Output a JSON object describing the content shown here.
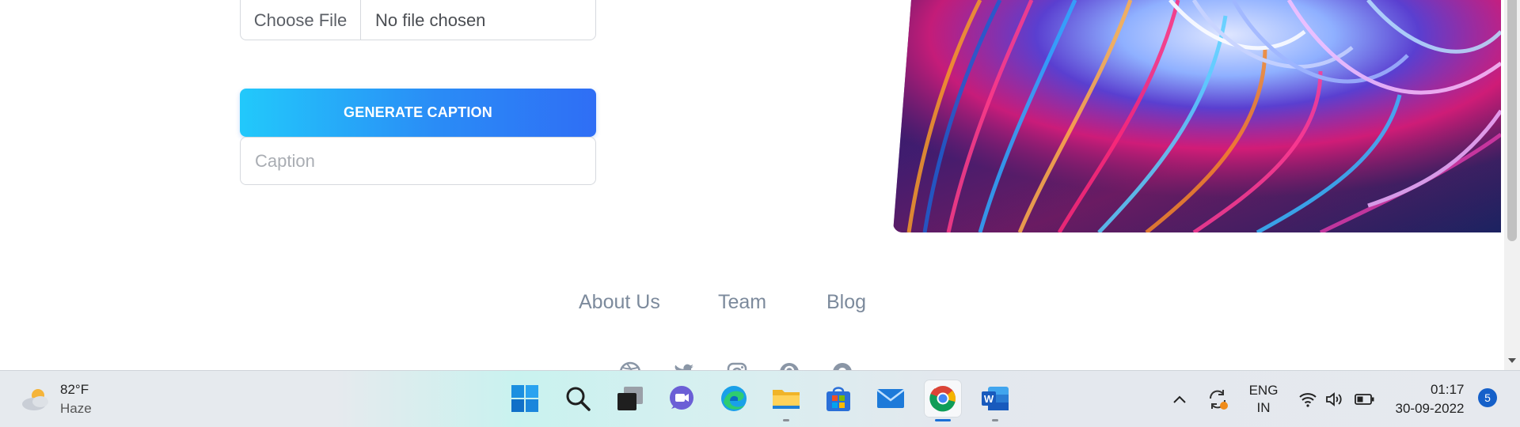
{
  "form": {
    "file_button_label": "Choose File",
    "file_status": "No file chosen",
    "generate_button_label": "GENERATE CAPTION",
    "caption_placeholder": "Caption",
    "caption_value": ""
  },
  "footer": {
    "links": [
      {
        "label": "About Us"
      },
      {
        "label": "Team"
      },
      {
        "label": "Blog"
      }
    ],
    "social_icons": [
      "dribbble-icon",
      "twitter-icon",
      "instagram-icon",
      "pinterest-icon",
      "github-icon"
    ]
  },
  "taskbar": {
    "weather": {
      "temperature": "82°F",
      "condition": "Haze"
    },
    "apps": [
      "start-icon",
      "search-icon",
      "task-view-icon",
      "teams-chat-icon",
      "edge-icon",
      "file-explorer-icon",
      "microsoft-store-icon",
      "mail-icon",
      "chrome-icon",
      "word-icon"
    ],
    "language": {
      "line1": "ENG",
      "line2": "IN"
    },
    "clock": {
      "time": "01:17",
      "date": "30-09-2022"
    },
    "notification_count": "5"
  },
  "colors": {
    "accent_gradient_start": "#22c9fb",
    "accent_gradient_end": "#2f6ef5",
    "footer_link": "#7c8a9c"
  }
}
